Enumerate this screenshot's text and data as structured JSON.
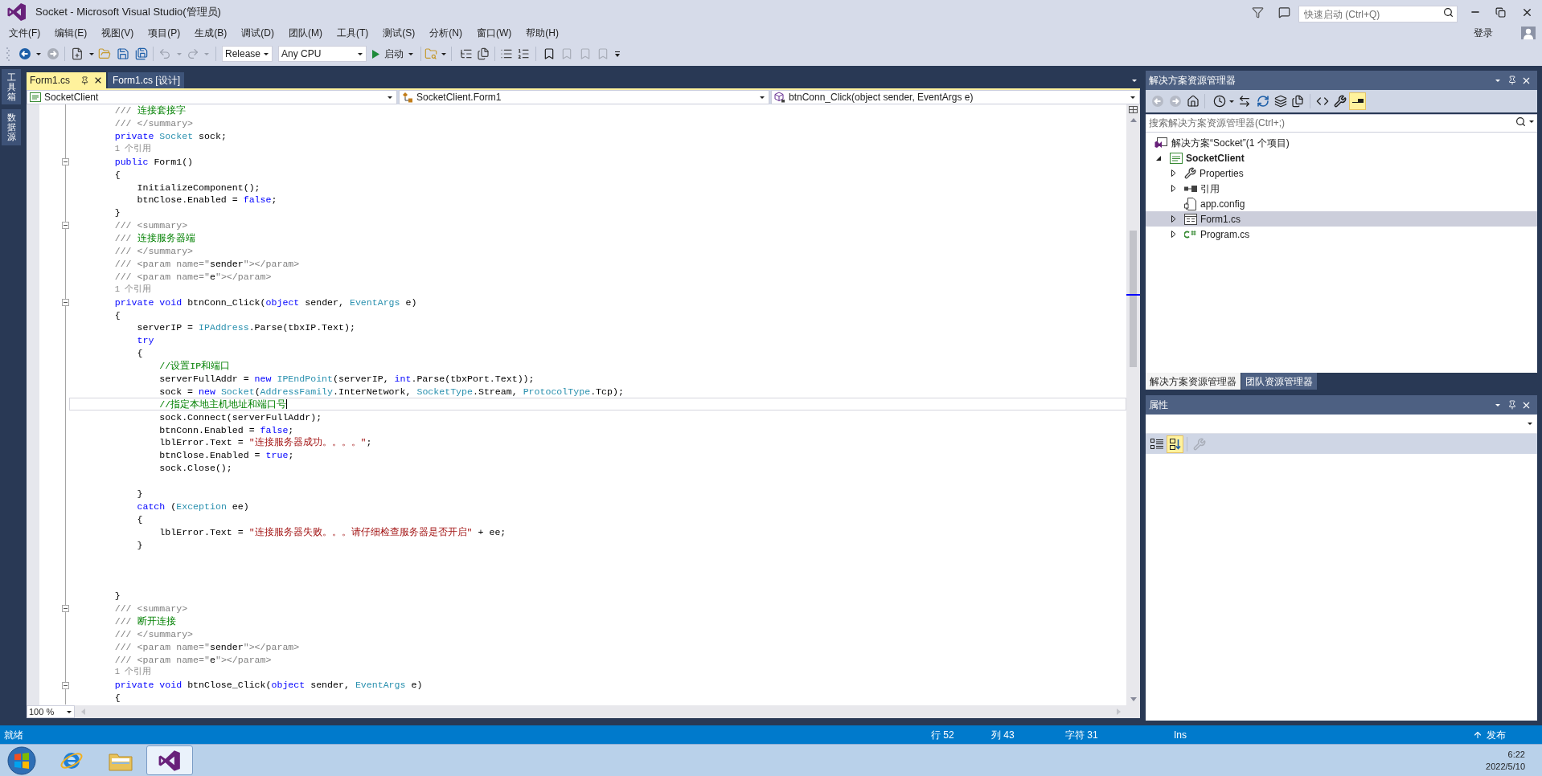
{
  "window": {
    "title": "Socket - Microsoft Visual Studio(管理员)"
  },
  "quick_launch": {
    "placeholder": "快速启动 (Ctrl+Q)"
  },
  "account": {
    "label": "登录"
  },
  "menu": [
    "文件(F)",
    "编辑(E)",
    "视图(V)",
    "项目(P)",
    "生成(B)",
    "调试(D)",
    "团队(M)",
    "工具(T)",
    "测试(S)",
    "分析(N)",
    "窗口(W)",
    "帮助(H)"
  ],
  "toolbar": {
    "configuration": "Release",
    "platform": "Any CPU",
    "start": "启动"
  },
  "side_tabs": [
    "工具箱",
    "数据源"
  ],
  "document_tabs": [
    {
      "label": "Form1.cs",
      "selected": true
    },
    {
      "label": "Form1.cs [设计]",
      "selected": false
    }
  ],
  "navigation": [
    {
      "kind": "project",
      "text": "SocketClient"
    },
    {
      "kind": "class",
      "text": "SocketClient.Form1"
    },
    {
      "kind": "method",
      "text": "btnConn_Click(object sender, EventArgs e)"
    }
  ],
  "editor": {
    "lines": [
      {
        "kind": "code",
        "fold": false,
        "current": false,
        "tokens": [
          {
            "text": "        /// ",
            "kind": "doc"
          },
          {
            "text": "连接套接字",
            "kind": "comment"
          }
        ]
      },
      {
        "kind": "code",
        "fold": false,
        "current": false,
        "tokens": [
          {
            "text": "        /// </summary>",
            "kind": "doc"
          }
        ]
      },
      {
        "kind": "code",
        "fold": false,
        "current": false,
        "tokens": [
          {
            "text": "        private ",
            "kind": "keyword"
          },
          {
            "text": "Socket",
            "kind": "type"
          },
          {
            "text": " sock;",
            "kind": "plain"
          }
        ]
      },
      {
        "kind": "codelens",
        "fold": false,
        "current": false,
        "text": "        1 个引用"
      },
      {
        "kind": "code",
        "fold": true,
        "current": false,
        "tokens": [
          {
            "text": "        public",
            "kind": "keyword"
          },
          {
            "text": " Form1()",
            "kind": "plain"
          }
        ]
      },
      {
        "kind": "code",
        "fold": false,
        "current": false,
        "tokens": [
          {
            "text": "        {",
            "kind": "plain"
          }
        ]
      },
      {
        "kind": "code",
        "fold": false,
        "current": false,
        "tokens": [
          {
            "text": "            InitializeComponent();",
            "kind": "plain"
          }
        ]
      },
      {
        "kind": "code",
        "fold": false,
        "current": false,
        "tokens": [
          {
            "text": "            btnClose.Enabled = ",
            "kind": "plain"
          },
          {
            "text": "false",
            "kind": "keyword"
          },
          {
            "text": ";",
            "kind": "plain"
          }
        ]
      },
      {
        "kind": "code",
        "fold": false,
        "current": false,
        "tokens": [
          {
            "text": "        }",
            "kind": "plain"
          }
        ]
      },
      {
        "kind": "code",
        "fold": true,
        "current": false,
        "tokens": [
          {
            "text": "        /// <summary>",
            "kind": "doc"
          }
        ]
      },
      {
        "kind": "code",
        "fold": false,
        "current": false,
        "tokens": [
          {
            "text": "        /// ",
            "kind": "doc"
          },
          {
            "text": "连接服务器端",
            "kind": "comment"
          }
        ]
      },
      {
        "kind": "code",
        "fold": false,
        "current": false,
        "tokens": [
          {
            "text": "        /// </summary>",
            "kind": "doc"
          }
        ]
      },
      {
        "kind": "code",
        "fold": false,
        "current": false,
        "tokens": [
          {
            "text": "        /// <param name=\"",
            "kind": "doc"
          },
          {
            "text": "sender",
            "kind": "plain"
          },
          {
            "text": "\"></param>",
            "kind": "doc"
          }
        ]
      },
      {
        "kind": "code",
        "fold": false,
        "current": false,
        "tokens": [
          {
            "text": "        /// <param name=\"",
            "kind": "doc"
          },
          {
            "text": "e",
            "kind": "plain"
          },
          {
            "text": "\"></param>",
            "kind": "doc"
          }
        ]
      },
      {
        "kind": "codelens",
        "fold": false,
        "current": false,
        "text": "        1 个引用"
      },
      {
        "kind": "code",
        "fold": true,
        "current": false,
        "tokens": [
          {
            "text": "        private void",
            "kind": "keyword"
          },
          {
            "text": " btnConn_Click(",
            "kind": "plain"
          },
          {
            "text": "object",
            "kind": "keyword"
          },
          {
            "text": " sender, ",
            "kind": "plain"
          },
          {
            "text": "EventArgs",
            "kind": "type"
          },
          {
            "text": " e)",
            "kind": "plain"
          }
        ]
      },
      {
        "kind": "code",
        "fold": false,
        "current": false,
        "tokens": [
          {
            "text": "        {",
            "kind": "plain"
          }
        ]
      },
      {
        "kind": "code",
        "fold": false,
        "current": false,
        "tokens": [
          {
            "text": "            serverIP = ",
            "kind": "plain"
          },
          {
            "text": "IPAddress",
            "kind": "type"
          },
          {
            "text": ".Parse(tbxIP.Text);",
            "kind": "plain"
          }
        ]
      },
      {
        "kind": "code",
        "fold": false,
        "current": false,
        "tokens": [
          {
            "text": "            try",
            "kind": "keyword"
          }
        ]
      },
      {
        "kind": "code",
        "fold": false,
        "current": false,
        "tokens": [
          {
            "text": "            {",
            "kind": "plain"
          }
        ]
      },
      {
        "kind": "code",
        "fold": false,
        "current": false,
        "tokens": [
          {
            "text": "                //设置IP和端口",
            "kind": "comment"
          }
        ]
      },
      {
        "kind": "code",
        "fold": false,
        "current": false,
        "tokens": [
          {
            "text": "                serverFullAddr = ",
            "kind": "plain"
          },
          {
            "text": "new ",
            "kind": "keyword"
          },
          {
            "text": "IPEndPoint",
            "kind": "type"
          },
          {
            "text": "(serverIP, ",
            "kind": "plain"
          },
          {
            "text": "int",
            "kind": "keyword"
          },
          {
            "text": ".Parse(tbxPort.Text));",
            "kind": "plain"
          }
        ]
      },
      {
        "kind": "code",
        "fold": false,
        "current": false,
        "tokens": [
          {
            "text": "                sock = ",
            "kind": "plain"
          },
          {
            "text": "new ",
            "kind": "keyword"
          },
          {
            "text": "Socket",
            "kind": "type"
          },
          {
            "text": "(",
            "kind": "plain"
          },
          {
            "text": "AddressFamily",
            "kind": "type"
          },
          {
            "text": ".InterNetwork, ",
            "kind": "plain"
          },
          {
            "text": "SocketType",
            "kind": "type"
          },
          {
            "text": ".Stream, ",
            "kind": "plain"
          },
          {
            "text": "ProtocolType",
            "kind": "type"
          },
          {
            "text": ".Tcp);",
            "kind": "plain"
          }
        ]
      },
      {
        "kind": "code",
        "fold": false,
        "current": true,
        "tokens": [
          {
            "text": "                //指定本地主机地址和端口号",
            "kind": "comment"
          }
        ]
      },
      {
        "kind": "code",
        "fold": false,
        "current": false,
        "tokens": [
          {
            "text": "                sock.Connect(serverFullAddr);",
            "kind": "plain"
          }
        ]
      },
      {
        "kind": "code",
        "fold": false,
        "current": false,
        "tokens": [
          {
            "text": "                btnConn.Enabled = ",
            "kind": "plain"
          },
          {
            "text": "false",
            "kind": "keyword"
          },
          {
            "text": ";",
            "kind": "plain"
          }
        ]
      },
      {
        "kind": "code",
        "fold": false,
        "current": false,
        "tokens": [
          {
            "text": "                lblError.Text = ",
            "kind": "plain"
          },
          {
            "text": "\"连接服务器成功。。。。\"",
            "kind": "string"
          },
          {
            "text": ";",
            "kind": "plain"
          }
        ]
      },
      {
        "kind": "code",
        "fold": false,
        "current": false,
        "tokens": [
          {
            "text": "                btnClose.Enabled = ",
            "kind": "plain"
          },
          {
            "text": "true",
            "kind": "keyword"
          },
          {
            "text": ";",
            "kind": "plain"
          }
        ]
      },
      {
        "kind": "code",
        "fold": false,
        "current": false,
        "tokens": [
          {
            "text": "                sock.Close();",
            "kind": "plain"
          }
        ]
      },
      {
        "kind": "blank",
        "fold": false,
        "current": false
      },
      {
        "kind": "code",
        "fold": false,
        "current": false,
        "tokens": [
          {
            "text": "            }",
            "kind": "plain"
          }
        ]
      },
      {
        "kind": "code",
        "fold": false,
        "current": false,
        "tokens": [
          {
            "text": "            catch",
            "kind": "keyword"
          },
          {
            "text": " (",
            "kind": "plain"
          },
          {
            "text": "Exception",
            "kind": "type"
          },
          {
            "text": " ee)",
            "kind": "plain"
          }
        ]
      },
      {
        "kind": "code",
        "fold": false,
        "current": false,
        "tokens": [
          {
            "text": "            {",
            "kind": "plain"
          }
        ]
      },
      {
        "kind": "code",
        "fold": false,
        "current": false,
        "tokens": [
          {
            "text": "                lblError.Text = ",
            "kind": "plain"
          },
          {
            "text": "\"连接服务器失败。。。请仔细检查服务器是否开启\"",
            "kind": "string"
          },
          {
            "text": " + ee;",
            "kind": "plain"
          }
        ]
      },
      {
        "kind": "code",
        "fold": false,
        "current": false,
        "tokens": [
          {
            "text": "            }",
            "kind": "plain"
          }
        ]
      },
      {
        "kind": "blank",
        "fold": false,
        "current": false
      },
      {
        "kind": "blank",
        "fold": false,
        "current": false
      },
      {
        "kind": "blank",
        "fold": false,
        "current": false
      },
      {
        "kind": "code",
        "fold": false,
        "current": false,
        "tokens": [
          {
            "text": "        }",
            "kind": "plain"
          }
        ]
      },
      {
        "kind": "code",
        "fold": true,
        "current": false,
        "tokens": [
          {
            "text": "        /// <summary>",
            "kind": "doc"
          }
        ]
      },
      {
        "kind": "code",
        "fold": false,
        "current": false,
        "tokens": [
          {
            "text": "        /// ",
            "kind": "doc"
          },
          {
            "text": "断开连接",
            "kind": "comment"
          }
        ]
      },
      {
        "kind": "code",
        "fold": false,
        "current": false,
        "tokens": [
          {
            "text": "        /// </summary>",
            "kind": "doc"
          }
        ]
      },
      {
        "kind": "code",
        "fold": false,
        "current": false,
        "tokens": [
          {
            "text": "        /// <param name=\"",
            "kind": "doc"
          },
          {
            "text": "sender",
            "kind": "plain"
          },
          {
            "text": "\"></param>",
            "kind": "doc"
          }
        ]
      },
      {
        "kind": "code",
        "fold": false,
        "current": false,
        "tokens": [
          {
            "text": "        /// <param name=\"",
            "kind": "doc"
          },
          {
            "text": "e",
            "kind": "plain"
          },
          {
            "text": "\"></param>",
            "kind": "doc"
          }
        ]
      },
      {
        "kind": "codelens",
        "fold": false,
        "current": false,
        "text": "        1 个引用"
      },
      {
        "kind": "code",
        "fold": true,
        "current": false,
        "tokens": [
          {
            "text": "        private void",
            "kind": "keyword"
          },
          {
            "text": " btnClose_Click(",
            "kind": "plain"
          },
          {
            "text": "object",
            "kind": "keyword"
          },
          {
            "text": " sender, ",
            "kind": "plain"
          },
          {
            "text": "EventArgs",
            "kind": "type"
          },
          {
            "text": " e)",
            "kind": "plain"
          }
        ]
      },
      {
        "kind": "code",
        "fold": false,
        "current": false,
        "tokens": [
          {
            "text": "        {",
            "kind": "plain"
          }
        ]
      }
    ],
    "zoom": "100 %"
  },
  "solution_explorer": {
    "title": "解决方案资源管理器",
    "search": {
      "placeholder": "搜索解决方案资源管理器(Ctrl+;)"
    },
    "tree": [
      {
        "label": "解决方案“Socket”(1 个项目)",
        "kind": "solution",
        "selected": false,
        "children": [
          {
            "label": "SocketClient",
            "kind": "project",
            "expanded": true,
            "selected": false,
            "children": [
              {
                "label": "Properties",
                "kind": "properties",
                "expanded": false,
                "selected": false
              },
              {
                "label": "引用",
                "kind": "references",
                "expanded": false,
                "selected": false
              },
              {
                "label": "app.config",
                "kind": "config",
                "selected": false
              },
              {
                "label": "Form1.cs",
                "kind": "form",
                "expanded": false,
                "selected": true
              },
              {
                "label": "Program.cs",
                "kind": "code",
                "expanded": false,
                "selected": false
              }
            ]
          }
        ]
      }
    ],
    "tabs": [
      {
        "label": "解决方案资源管理器",
        "selected": true
      },
      {
        "label": "团队资源管理器",
        "selected": false
      }
    ]
  },
  "properties": {
    "title": "属性"
  },
  "status_bar": {
    "message": "就绪",
    "line": "行 52",
    "column": "列 43",
    "character": "字符 31",
    "mode": "Ins",
    "publish": "发布"
  },
  "taskbar": {
    "apps": [
      {
        "kind": "browser",
        "selected": false
      },
      {
        "kind": "files",
        "selected": false
      },
      {
        "kind": "ide",
        "selected": true
      }
    ],
    "time": "6:22",
    "date": "2022/5/10"
  }
}
